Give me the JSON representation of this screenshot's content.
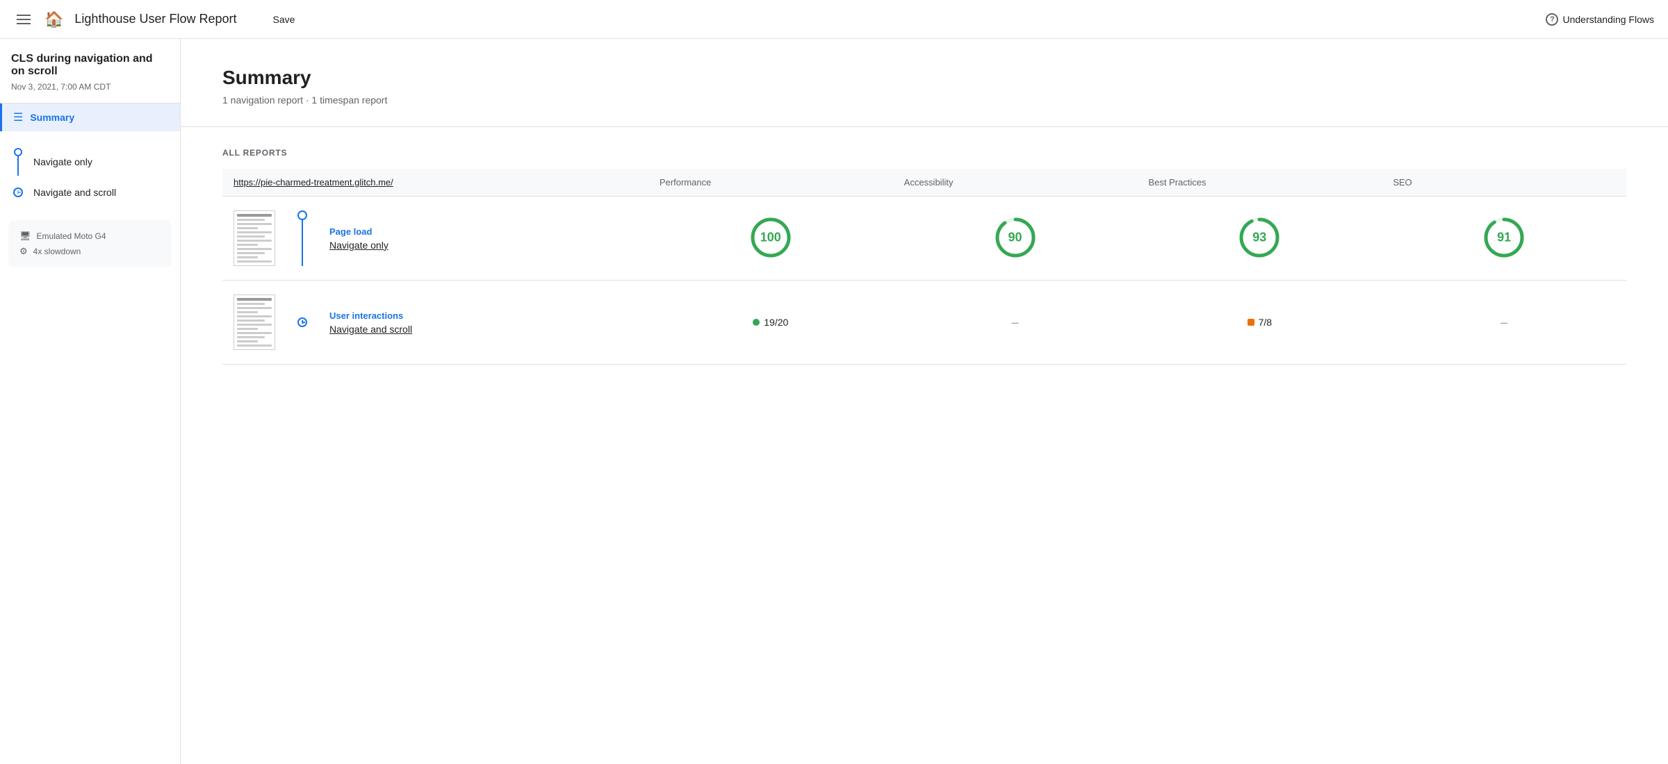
{
  "header": {
    "title": "Lighthouse User Flow Report",
    "save_label": "Save",
    "help_label": "Understanding Flows",
    "logo": "🏠"
  },
  "sidebar": {
    "project_title": "CLS during navigation and on scroll",
    "project_date": "Nov 3, 2021, 7:00 AM CDT",
    "summary_label": "Summary",
    "flows": [
      {
        "label": "Navigate only",
        "type": "dot"
      },
      {
        "label": "Navigate and scroll",
        "type": "clock"
      }
    ],
    "settings": [
      {
        "icon": "🖥",
        "label": "Emulated Moto G4"
      },
      {
        "icon": "⚙",
        "label": "4x slowdown"
      }
    ]
  },
  "summary": {
    "heading": "Summary",
    "sub": "1 navigation report · 1 timespan report"
  },
  "reports": {
    "section_label": "ALL REPORTS",
    "columns": {
      "url": "https://pie-charmed-treatment.glitch.me/",
      "performance": "Performance",
      "accessibility": "Accessibility",
      "best_practices": "Best Practices",
      "seo": "SEO"
    },
    "rows": [
      {
        "type": "Page load",
        "name": "Navigate only",
        "connector": "dot",
        "scores": {
          "performance": 100,
          "accessibility": 90,
          "best_practices": 93,
          "seo": 91
        }
      },
      {
        "type": "User interactions",
        "name": "Navigate and scroll",
        "connector": "clock",
        "scores": {
          "performance": "19/20",
          "performance_type": "dot-green",
          "accessibility": "–",
          "best_practices": "7/8",
          "best_practices_type": "square-orange",
          "seo": "–"
        }
      }
    ],
    "colors": {
      "green": "#1e8e3e",
      "circle_stroke": "#34a853",
      "score_high": "#1e8e3e"
    }
  }
}
